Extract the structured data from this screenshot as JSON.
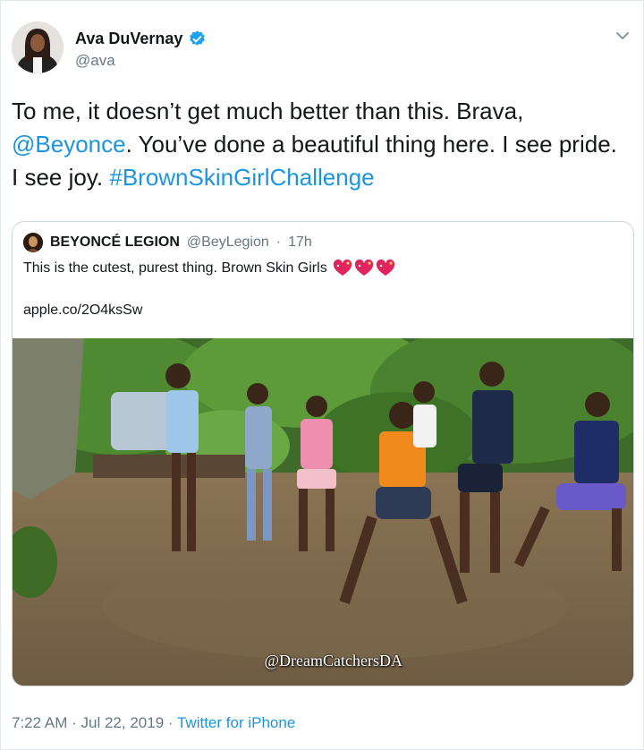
{
  "author": {
    "display_name": "Ava DuVernay",
    "handle": "@ava",
    "verified_icon": "verified-badge-icon"
  },
  "tweet": {
    "text_before_1": "To me, it doesn’t get much better than this. Brava, ",
    "mention": "@Beyonce",
    "text_after_mention": ". You’ve done a beautiful thing here. I see pride. I see joy. ",
    "hashtag": "#BrownSkinGirlChallenge"
  },
  "quoted": {
    "name": "BEYONCÉ LEGION",
    "handle": "@BeyLegion",
    "separator": "·",
    "age": "17h",
    "text": "This is the cutest, purest thing. Brown Skin Girls",
    "link": "apple.co/2O4ksSw",
    "watermark": "@DreamCatchersDA"
  },
  "footer": {
    "time": "7:22 AM",
    "dot1": "·",
    "date": "Jul 22, 2019",
    "dot2": "·",
    "source": "Twitter for iPhone"
  },
  "colors": {
    "link": "#1b95e0",
    "muted": "#657786",
    "border": "#ccd6dd",
    "verified": "#1da1f2"
  }
}
